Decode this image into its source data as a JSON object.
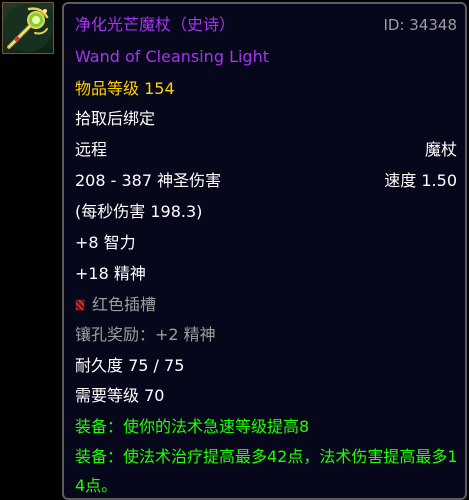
{
  "item": {
    "name": "净化光芒魔杖（史诗）",
    "id_label": "ID: 34348",
    "english_name": "Wand of Cleansing Light",
    "item_level_label": "物品等级",
    "item_level_value": "154",
    "binding": "拾取后绑定",
    "slot": "远程",
    "type": "魔杖",
    "damage": "208 - 387 神圣伤害",
    "speed": "速度 1.50",
    "dps": "(每秒伤害 198.3)",
    "stat_int": "+8 智力",
    "stat_spi": "+18 精神",
    "socket_label": "红色插槽",
    "socket_bonus": "镶孔奖励：+2 精神",
    "durability": "耐久度 75 / 75",
    "required_level": "需要等级 70",
    "equip_1": "装备：使你的法术急速等级提高8",
    "equip_2": "装备：使法术治疗提高最多42点，法术伤害提高最多14点。"
  },
  "icon": {
    "name": "wand-icon"
  },
  "colors": {
    "epic": "#a335ee",
    "gold": "#ffd100",
    "grey": "#9d9d9d",
    "green": "#1eff00",
    "background": "#07071c",
    "border": "#5d5d5d"
  }
}
